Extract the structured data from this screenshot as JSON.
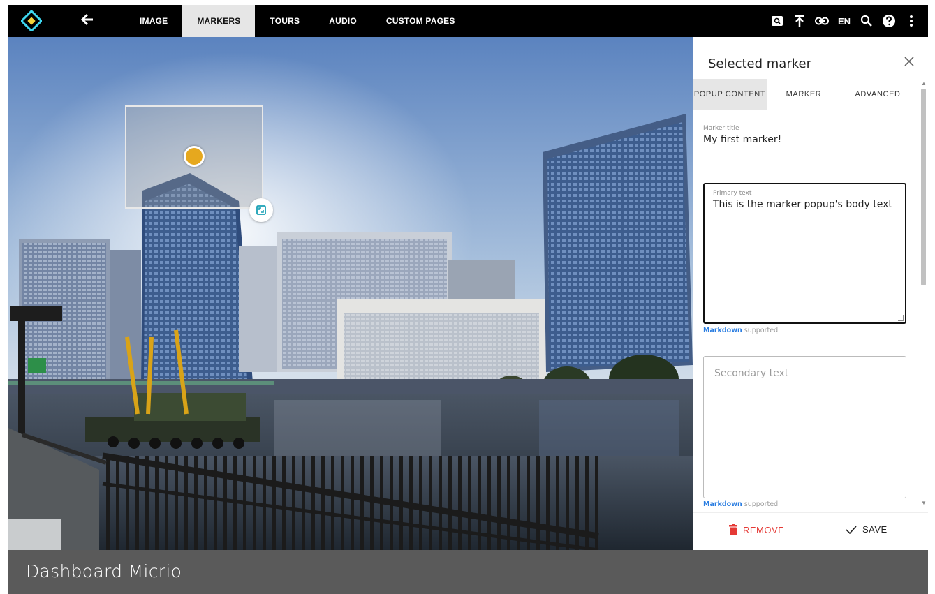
{
  "topbar": {
    "logo_icon": "micrio-diamond-logo",
    "back_icon": "arrow-left-icon",
    "tabs": [
      {
        "label": "IMAGE",
        "active": false
      },
      {
        "label": "MARKERS",
        "active": true
      },
      {
        "label": "TOURS",
        "active": false
      },
      {
        "label": "AUDIO",
        "active": false
      },
      {
        "label": "CUSTOM PAGES",
        "active": false
      }
    ],
    "right_icons": [
      "image-search-icon",
      "upload-icon",
      "link-icon",
      "language-selector",
      "search-icon",
      "help-icon",
      "more-vert-icon"
    ],
    "language": "EN",
    "colors": {
      "background": "#000000",
      "active_tab_bg": "#e6e6e6",
      "logo_accent": "#3ed7f0"
    }
  },
  "canvas": {
    "marker_color": "#e6a81e",
    "marker_icon": "marker-dot",
    "resize_icon": "expand-icon"
  },
  "panel": {
    "title": "Selected marker",
    "close_icon": "close-icon",
    "tabs": [
      {
        "label": "POPUP CONTENT",
        "active": true
      },
      {
        "label": "MARKER",
        "active": false
      },
      {
        "label": "ADVANCED",
        "active": false
      }
    ],
    "marker_title": {
      "label": "Marker title",
      "value": "My first marker!"
    },
    "primary_text": {
      "label": "Primary text",
      "value": "This is the marker popup's body text"
    },
    "secondary_text": {
      "placeholder": "Secondary text",
      "value": ""
    },
    "markdown_note": {
      "link": "Markdown",
      "suffix": "supported"
    },
    "footer": {
      "remove_label": "REMOVE",
      "remove_icon": "trash-icon",
      "save_label": "SAVE",
      "save_icon": "check-icon",
      "remove_color": "#e53935"
    }
  },
  "caption": {
    "text": "Dashboard Micrio"
  }
}
